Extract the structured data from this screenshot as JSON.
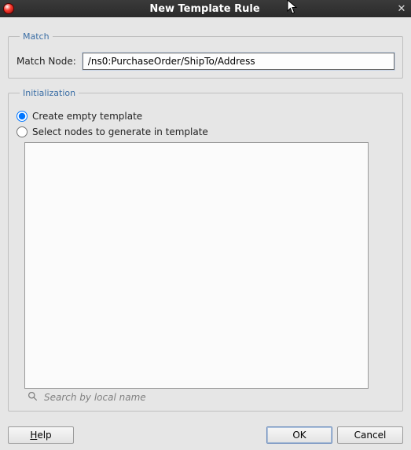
{
  "window": {
    "title": "New Template Rule"
  },
  "match": {
    "legend": "Match",
    "label": "Match Node:",
    "value": "/ns0:PurchaseOrder/ShipTo/Address"
  },
  "init": {
    "legend": "Initialization",
    "radio_empty": "Create empty template",
    "radio_select": "Select nodes to generate in template",
    "selected": "empty",
    "search_placeholder": "Search by local name"
  },
  "buttons": {
    "help": "Help",
    "ok": "OK",
    "cancel": "Cancel"
  },
  "icons": {
    "search": "search-icon",
    "close": "close-icon",
    "app": "app-icon"
  }
}
